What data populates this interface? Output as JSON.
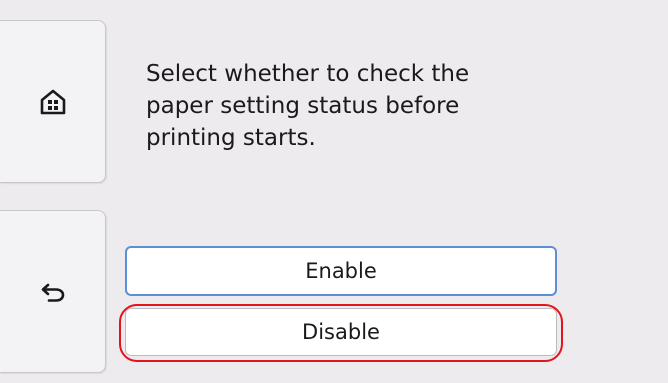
{
  "nav": {
    "home_icon": "home-icon",
    "back_icon": "back-arrow-icon"
  },
  "message": {
    "line1": "Select whether to check the",
    "line2": "paper setting status before",
    "line3": "printing starts."
  },
  "options": {
    "enable_label": "Enable",
    "disable_label": "Disable"
  },
  "colors": {
    "selected_border": "#5b8fd6",
    "highlight_ring": "#e3141b",
    "background": "#edebee"
  }
}
